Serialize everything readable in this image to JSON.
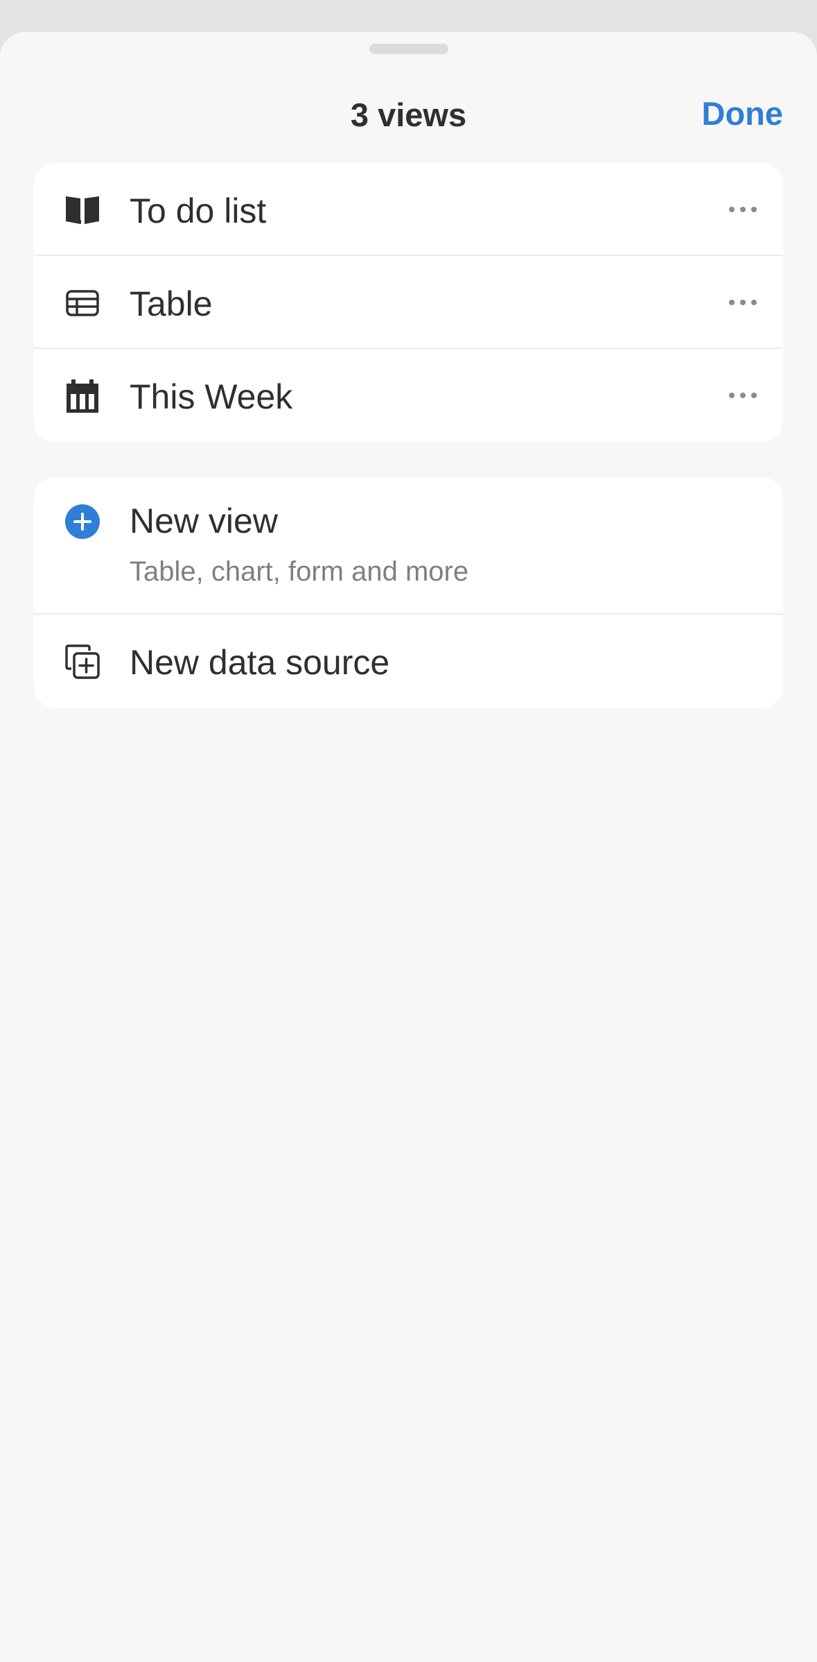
{
  "header": {
    "title": "3 views",
    "done_label": "Done"
  },
  "views": [
    {
      "label": "To do list",
      "icon": "book-open-icon"
    },
    {
      "label": "Table",
      "icon": "table-icon"
    },
    {
      "label": "This Week",
      "icon": "calendar-icon"
    }
  ],
  "actions": {
    "new_view": {
      "label": "New view",
      "sublabel": "Table, chart, form and more",
      "icon": "plus-circle-icon"
    },
    "new_data_source": {
      "label": "New data source",
      "icon": "duplicate-plus-icon"
    }
  },
  "colors": {
    "accent": "#2f7ed8",
    "text": "#2f2f2f",
    "secondary_text": "#7f7f7d",
    "sheet_background": "#f8f7f5",
    "card_background": "#ffffff"
  }
}
